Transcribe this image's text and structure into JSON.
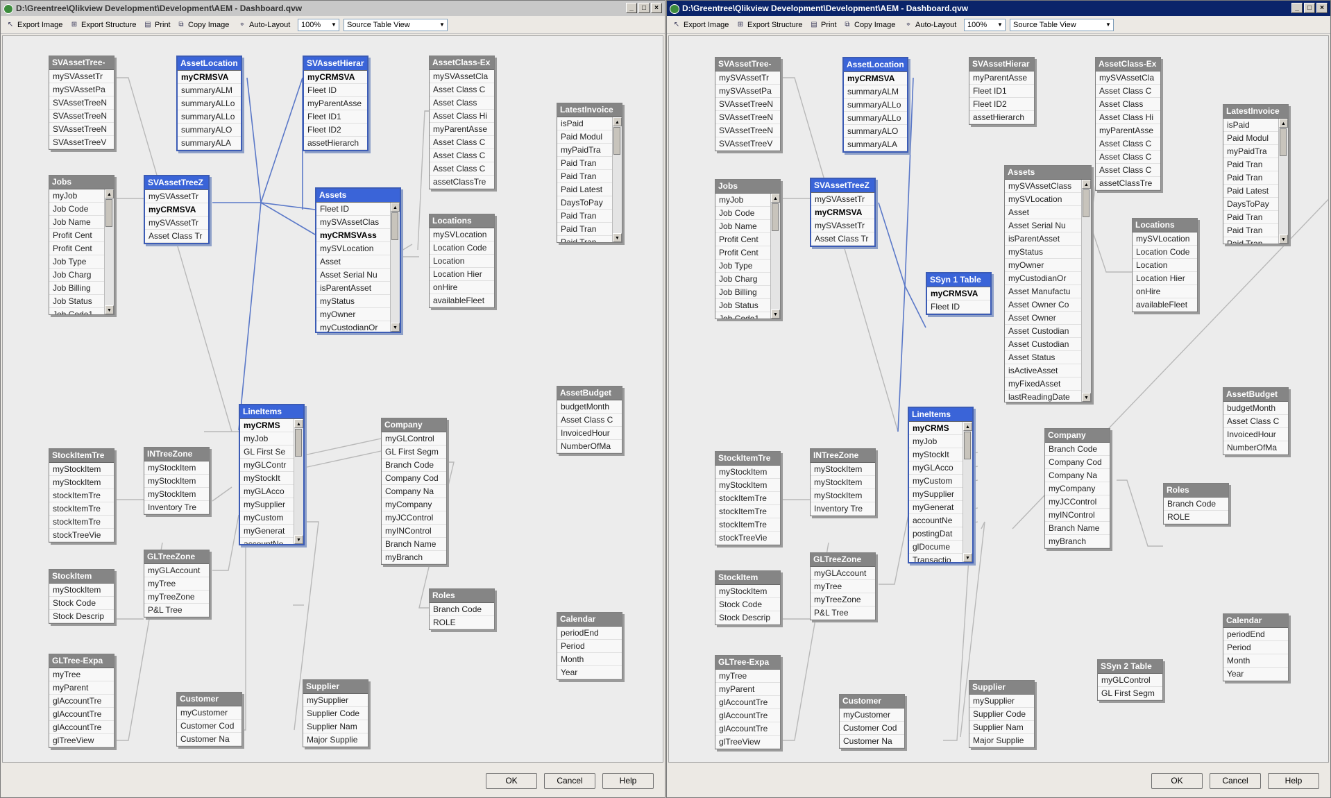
{
  "windows": [
    {
      "title": "D:\\Greentree\\Qlikview Development\\Development\\AEM - Dashboard.qvw",
      "active": false,
      "toolbar": {
        "export_image": "Export Image",
        "export_structure": "Export Structure",
        "print": "Print",
        "copy_image": "Copy Image",
        "auto_layout": "Auto-Layout",
        "zoom": "100%",
        "view": "Source Table View"
      },
      "buttons": {
        "ok": "OK",
        "cancel": "Cancel",
        "help": "Help"
      },
      "tables": [
        {
          "name": "SVAssetTree-",
          "rows": [
            "mySVAssetTr",
            "mySVAssetPa",
            "SVAssetTreeN",
            "SVAssetTreeN",
            "SVAssetTreeN",
            "SVAssetTreeV"
          ]
        },
        {
          "name": "AssetLocation",
          "sel": true,
          "rows": [
            "myCRMSVA",
            "summaryALM",
            "summaryALLo",
            "summaryALLo",
            "summaryALO",
            "summaryALA"
          ],
          "bold": [
            0
          ]
        },
        {
          "name": "SVAssetHierar",
          "sel": true,
          "rows": [
            "myCRMSVA",
            "Fleet ID",
            "myParentAsse",
            "Fleet ID1",
            "Fleet ID2",
            "assetHierarch"
          ],
          "bold": [
            0
          ]
        },
        {
          "name": "AssetClass-Ex",
          "rows": [
            "mySVAssetCla",
            "Asset Class C",
            "Asset Class",
            "Asset Class Hi",
            "myParentAsse",
            "Asset Class C",
            "Asset Class C",
            "Asset Class C",
            "assetClassTre"
          ]
        },
        {
          "name": "LatestInvoice",
          "scroll": true,
          "rows": [
            "isPaid",
            "Paid Modul",
            "myPaidTra",
            "Paid Tran",
            "Paid Tran",
            "Paid Latest",
            "DaysToPay",
            "Paid Tran",
            "Paid Tran",
            "Paid Tran"
          ]
        },
        {
          "name": "Jobs",
          "scroll": true,
          "rows": [
            "myJob",
            "Job Code",
            "Job Name",
            "Profit Cent",
            "Profit Cent",
            "Job Type",
            "Job Charg",
            "Job Billing",
            "Job Status",
            "Job Code1"
          ]
        },
        {
          "name": "SVAssetTreeZ",
          "sel": true,
          "rows": [
            "mySVAssetTr",
            "myCRMSVA",
            "mySVAssetTr",
            "Asset Class Tr"
          ],
          "bold": [
            1
          ]
        },
        {
          "name": "Assets",
          "sel": true,
          "scroll": true,
          "rows": [
            "Fleet ID",
            "mySVAssetClas",
            "myCRMSVAss",
            "mySVLocation",
            "Asset",
            "Asset Serial Nu",
            "isParentAsset",
            "myStatus",
            "myOwner",
            "myCustodianOr"
          ],
          "bold": [
            2
          ]
        },
        {
          "name": "Locations",
          "rows": [
            "mySVLocation",
            "Location Code",
            "Location",
            "Location Hier",
            "onHire",
            "availableFleet"
          ]
        },
        {
          "name": "AssetBudget",
          "rows": [
            "budgetMonth",
            "Asset Class C",
            "InvoicedHour",
            "NumberOfMa"
          ]
        },
        {
          "name": "LineItems",
          "sel": true,
          "scroll": true,
          "rows": [
            "myCRMS",
            "myJob",
            "GL First Se",
            "myGLContr",
            "myStockIt",
            "myGLAcco",
            "mySupplier",
            "myCustom",
            "myGenerat",
            "accountNe"
          ],
          "bold": [
            0
          ]
        },
        {
          "name": "Company",
          "rows": [
            "myGLControl",
            "GL First Segm",
            "Branch Code",
            "Company Cod",
            "Company Na",
            "myCompany",
            "myJCControl",
            "myINControl",
            "Branch Name",
            "myBranch"
          ]
        },
        {
          "name": "StockItemTre",
          "rows": [
            "myStockItem",
            "myStockItem",
            "stockItemTre",
            "stockItemTre",
            "stockItemTre",
            "stockTreeVie"
          ]
        },
        {
          "name": "INTreeZone",
          "rows": [
            "myStockItem",
            "myStockItem",
            "myStockItem",
            "Inventory Tre"
          ]
        },
        {
          "name": "StockItem",
          "rows": [
            "myStockItem",
            "Stock Code",
            "Stock Descrip"
          ]
        },
        {
          "name": "GLTreeZone",
          "rows": [
            "myGLAccount",
            "myTree",
            "myTreeZone",
            "P&L Tree"
          ]
        },
        {
          "name": "Roles",
          "rows": [
            "Branch Code",
            "ROLE"
          ]
        },
        {
          "name": "Calendar",
          "rows": [
            "periodEnd",
            "Period",
            "Month",
            "Year"
          ]
        },
        {
          "name": "GLTree-Expa",
          "rows": [
            "myTree",
            "myParent",
            "glAccountTre",
            "glAccountTre",
            "glAccountTre",
            "glTreeView"
          ]
        },
        {
          "name": "Customer",
          "rows": [
            "myCustomer",
            "Customer Cod",
            "Customer Na"
          ]
        },
        {
          "name": "Supplier",
          "rows": [
            "mySupplier",
            "Supplier Code",
            "Supplier Nam",
            "Major Supplie"
          ]
        }
      ]
    },
    {
      "title": "D:\\Greentree\\Qlikview Development\\Development\\AEM - Dashboard.qvw",
      "active": true,
      "toolbar": {
        "export_image": "Export Image",
        "export_structure": "Export Structure",
        "print": "Print",
        "copy_image": "Copy Image",
        "auto_layout": "Auto-Layout",
        "zoom": "100%",
        "view": "Source Table View"
      },
      "buttons": {
        "ok": "OK",
        "cancel": "Cancel",
        "help": "Help"
      },
      "tables": [
        {
          "name": "SVAssetTree-",
          "rows": [
            "mySVAssetTr",
            "mySVAssetPa",
            "SVAssetTreeN",
            "SVAssetTreeN",
            "SVAssetTreeN",
            "SVAssetTreeV"
          ]
        },
        {
          "name": "AssetLocation",
          "sel": true,
          "rows": [
            "myCRMSVA",
            "summaryALM",
            "summaryALLo",
            "summaryALLo",
            "summaryALO",
            "summaryALA"
          ],
          "bold": [
            0
          ]
        },
        {
          "name": "SVAssetHierar",
          "rows": [
            "myParentAsse",
            "Fleet ID1",
            "Fleet ID2",
            "assetHierarch"
          ]
        },
        {
          "name": "AssetClass-Ex",
          "rows": [
            "mySVAssetCla",
            "Asset Class C",
            "Asset Class",
            "Asset Class Hi",
            "myParentAsse",
            "Asset Class C",
            "Asset Class C",
            "Asset Class C",
            "assetClassTre"
          ]
        },
        {
          "name": "LatestInvoice",
          "scroll": true,
          "rows": [
            "isPaid",
            "Paid Modul",
            "myPaidTra",
            "Paid Tran",
            "Paid Tran",
            "Paid Latest",
            "DaysToPay",
            "Paid Tran",
            "Paid Tran",
            "Paid Tran"
          ]
        },
        {
          "name": "Jobs",
          "scroll": true,
          "rows": [
            "myJob",
            "Job Code",
            "Job Name",
            "Profit Cent",
            "Profit Cent",
            "Job Type",
            "Job Charg",
            "Job Billing",
            "Job Status",
            "Job Code1"
          ]
        },
        {
          "name": "SVAssetTreeZ",
          "sel": true,
          "rows": [
            "mySVAssetTr",
            "myCRMSVA",
            "mySVAssetTr",
            "Asset Class Tr"
          ],
          "bold": [
            1
          ]
        },
        {
          "name": "Assets",
          "scroll": true,
          "rows": [
            "mySVAssetClass",
            "mySVLocation",
            "Asset",
            "Asset Serial Nu",
            "isParentAsset",
            "myStatus",
            "myOwner",
            "myCustodianOr",
            "Asset Manufactu",
            "Asset Owner Co",
            "Asset Owner",
            "Asset Custodian",
            "Asset Custodian",
            "Asset Status",
            "isActiveAsset",
            "myFixedAsset",
            "lastReadingDate"
          ]
        },
        {
          "name": "SSyn 1 Table",
          "sel": true,
          "rows": [
            "myCRMSVA",
            "Fleet ID"
          ],
          "bold": [
            0
          ]
        },
        {
          "name": "Locations",
          "rows": [
            "mySVLocation",
            "Location Code",
            "Location",
            "Location Hier",
            "onHire",
            "availableFleet"
          ]
        },
        {
          "name": "AssetBudget",
          "rows": [
            "budgetMonth",
            "Asset Class C",
            "InvoicedHour",
            "NumberOfMa"
          ]
        },
        {
          "name": "LineItems",
          "sel": true,
          "scroll": true,
          "rows": [
            "myCRMS",
            "myJob",
            "myStockIt",
            "myGLAcco",
            "myCustom",
            "mySupplier",
            "myGenerat",
            "accountNe",
            "postingDat",
            "glDocume",
            "Transactio"
          ],
          "bold": [
            0
          ]
        },
        {
          "name": "Company",
          "rows": [
            "Branch Code",
            "Company Cod",
            "Company Na",
            "myCompany",
            "myJCControl",
            "myINControl",
            "Branch Name",
            "myBranch"
          ]
        },
        {
          "name": "StockItemTre",
          "rows": [
            "myStockItem",
            "myStockItem",
            "stockItemTre",
            "stockItemTre",
            "stockItemTre",
            "stockTreeVie"
          ]
        },
        {
          "name": "INTreeZone",
          "rows": [
            "myStockItem",
            "myStockItem",
            "myStockItem",
            "Inventory Tre"
          ]
        },
        {
          "name": "Roles",
          "rows": [
            "Branch Code",
            "ROLE"
          ]
        },
        {
          "name": "StockItem",
          "rows": [
            "myStockItem",
            "Stock Code",
            "Stock Descrip"
          ]
        },
        {
          "name": "GLTreeZone",
          "rows": [
            "myGLAccount",
            "myTree",
            "myTreeZone",
            "P&L Tree"
          ]
        },
        {
          "name": "Calendar",
          "rows": [
            "periodEnd",
            "Period",
            "Month",
            "Year"
          ]
        },
        {
          "name": "SSyn 2 Table",
          "rows": [
            "myGLControl",
            "GL First Segm"
          ]
        },
        {
          "name": "GLTree-Expa",
          "rows": [
            "myTree",
            "myParent",
            "glAccountTre",
            "glAccountTre",
            "glAccountTre",
            "glTreeView"
          ]
        },
        {
          "name": "Customer",
          "rows": [
            "myCustomer",
            "Customer Cod",
            "Customer Na"
          ]
        },
        {
          "name": "Supplier",
          "rows": [
            "mySupplier",
            "Supplier Code",
            "Supplier Nam",
            "Major Supplie"
          ]
        }
      ]
    }
  ]
}
